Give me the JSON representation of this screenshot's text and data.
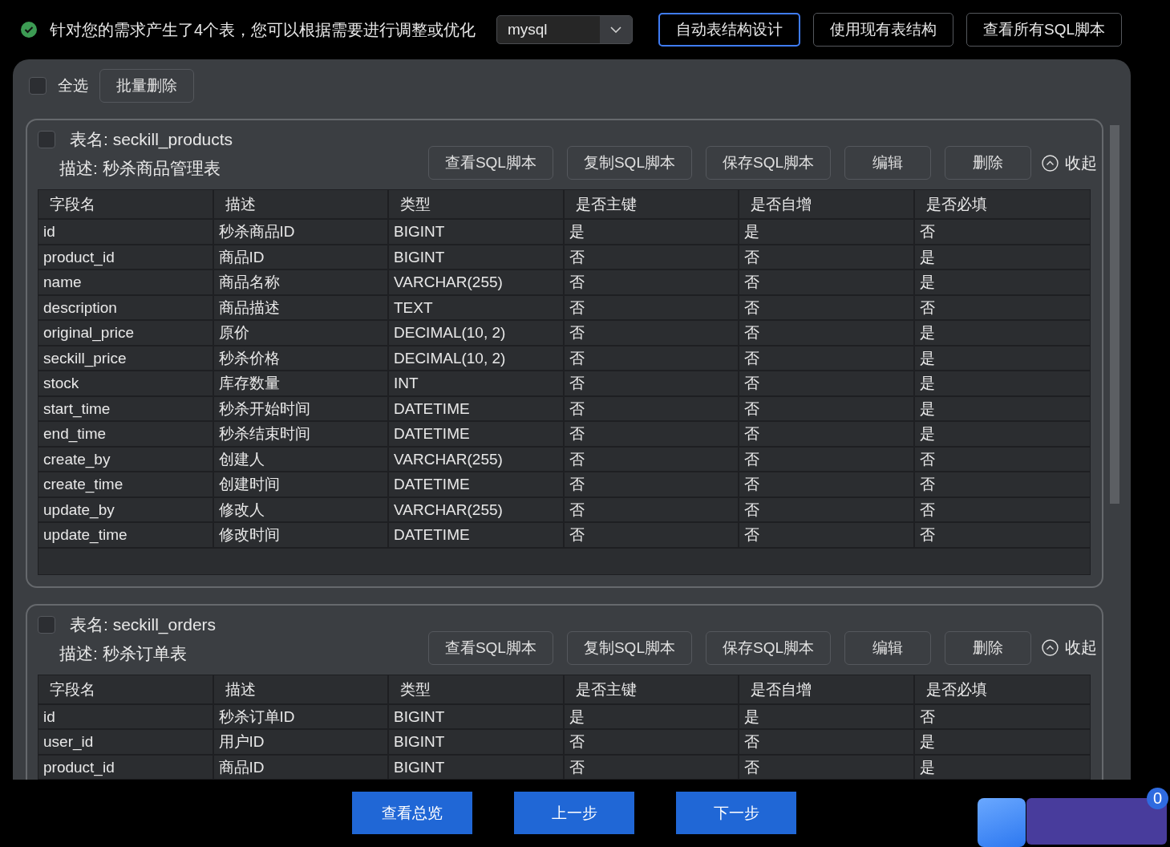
{
  "status": {
    "message": "针对您的需求产生了4个表，您可以根据需要进行调整或优化"
  },
  "db_select": {
    "value": "mysql"
  },
  "mode_buttons": [
    {
      "label": "自动表结构设计",
      "selected": true
    },
    {
      "label": "使用现有表结构",
      "selected": false
    },
    {
      "label": "查看所有SQL脚本",
      "selected": false
    }
  ],
  "toolbar": {
    "select_all": {
      "label": "全选",
      "checked": false
    },
    "bulk_delete": "批量删除"
  },
  "tables": [
    {
      "checked": false,
      "name": "表名: seckill_products",
      "description": "描述: 秒杀商品管理表",
      "actions": [
        "查看SQL脚本",
        "复制SQL脚本",
        "保存SQL脚本",
        "编辑",
        "删除"
      ],
      "collapse": "收起",
      "columns": [
        "字段名",
        "描述",
        "类型",
        "是否主键",
        "是否自增",
        "是否必填"
      ],
      "rows": [
        [
          "id",
          "秒杀商品ID",
          "BIGINT",
          "是",
          "是",
          "否"
        ],
        [
          "product_id",
          "商品ID",
          "BIGINT",
          "否",
          "否",
          "是"
        ],
        [
          "name",
          "商品名称",
          "VARCHAR(255)",
          "否",
          "否",
          "是"
        ],
        [
          "description",
          "商品描述",
          "TEXT",
          "否",
          "否",
          "否"
        ],
        [
          "original_price",
          "原价",
          "DECIMAL(10, 2)",
          "否",
          "否",
          "是"
        ],
        [
          "seckill_price",
          "秒杀价格",
          "DECIMAL(10, 2)",
          "否",
          "否",
          "是"
        ],
        [
          "stock",
          "库存数量",
          "INT",
          "否",
          "否",
          "是"
        ],
        [
          "start_time",
          "秒杀开始时间",
          "DATETIME",
          "否",
          "否",
          "是"
        ],
        [
          "end_time",
          "秒杀结束时间",
          "DATETIME",
          "否",
          "否",
          "是"
        ],
        [
          "create_by",
          "创建人",
          "VARCHAR(255)",
          "否",
          "否",
          "否"
        ],
        [
          "create_time",
          "创建时间",
          "DATETIME",
          "否",
          "否",
          "否"
        ],
        [
          "update_by",
          "修改人",
          "VARCHAR(255)",
          "否",
          "否",
          "否"
        ],
        [
          "update_time",
          "修改时间",
          "DATETIME",
          "否",
          "否",
          "否"
        ]
      ]
    },
    {
      "checked": false,
      "name": "表名: seckill_orders",
      "description": "描述: 秒杀订单表",
      "actions": [
        "查看SQL脚本",
        "复制SQL脚本",
        "保存SQL脚本",
        "编辑",
        "删除"
      ],
      "collapse": "收起",
      "columns": [
        "字段名",
        "描述",
        "类型",
        "是否主键",
        "是否自增",
        "是否必填"
      ],
      "rows": [
        [
          "id",
          "秒杀订单ID",
          "BIGINT",
          "是",
          "是",
          "否"
        ],
        [
          "user_id",
          "用户ID",
          "BIGINT",
          "否",
          "否",
          "是"
        ],
        [
          "product_id",
          "商品ID",
          "BIGINT",
          "否",
          "否",
          "是"
        ]
      ]
    }
  ],
  "footer_buttons": [
    "查看总览",
    "上一步",
    "下一步"
  ],
  "floating": {
    "badge": "0"
  }
}
